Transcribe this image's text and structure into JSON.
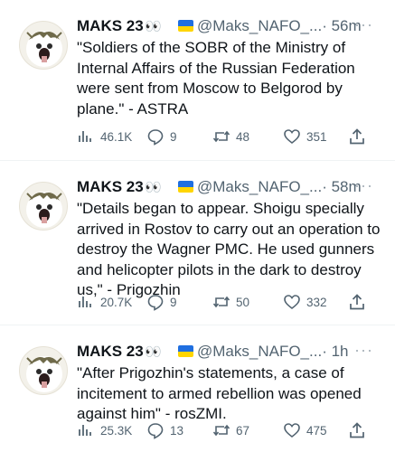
{
  "tweets": [
    {
      "name": "MAKS 23",
      "eyes": "👀",
      "handle": "@Maks_NAFO_...",
      "time": "· 56m",
      "more": "···",
      "text": "\"Soldiers of the SOBR of the Ministry of Internal Affairs of the Russian Federation were sent from Moscow to Belgorod by plane.\" - ASTRA",
      "views": "46.1K",
      "replies": "9",
      "retweets": "48",
      "likes": "351"
    },
    {
      "name": "MAKS 23",
      "eyes": "👀",
      "handle": "@Maks_NAFO_...",
      "time": "· 58m",
      "more": "···",
      "text": "\"Details began to appear. Shoigu specially arrived in Rostov to carry out an operation to destroy the Wagner PMC. He used gunners and helicopter pilots in the dark to destroy us,\" - Prigozhin",
      "views": "20.7K",
      "replies": "9",
      "retweets": "50",
      "likes": "332"
    },
    {
      "name": "MAKS 23",
      "eyes": "👀",
      "handle": "@Maks_NAFO_...",
      "time": "· 1h",
      "more": "···",
      "text": "\"After Prigozhin's statements, a case of incitement to armed rebellion was opened against him\" - rosZMI.",
      "views": "25.3K",
      "replies": "13",
      "retweets": "67",
      "likes": "475"
    }
  ],
  "colors": {
    "text": "#0f1419",
    "secondary": "#536471",
    "divider": "#eff3f4",
    "flag_blue": "#1f6fe0",
    "flag_yellow": "#ffd500"
  }
}
